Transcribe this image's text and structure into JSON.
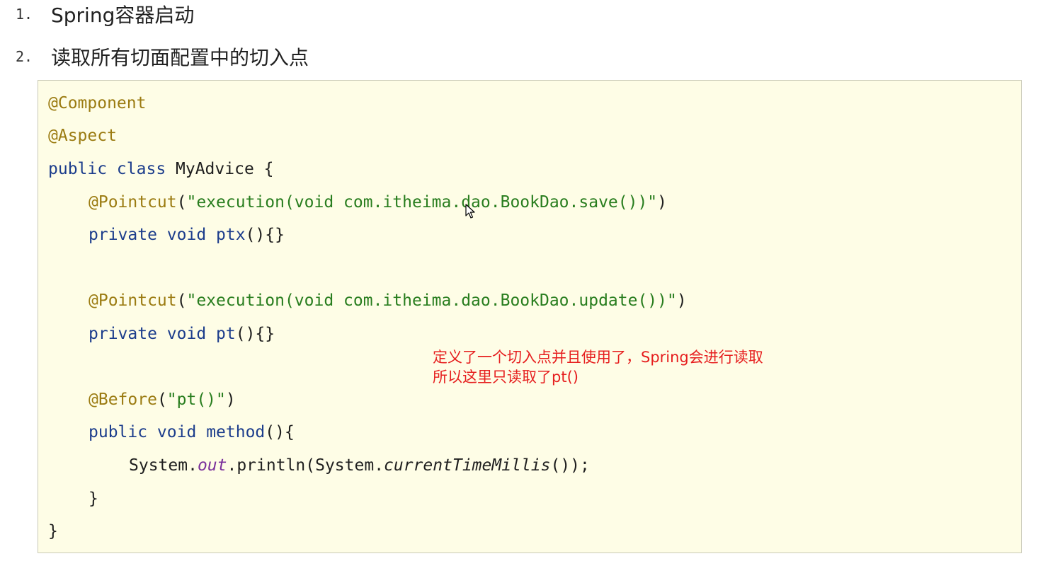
{
  "list": [
    {
      "number": "1.",
      "text": "Spring容器启动"
    },
    {
      "number": "2.",
      "text": "读取所有切面配置中的切入点"
    }
  ],
  "code": {
    "l1_ann": "@Component",
    "l2_ann": "@Aspect",
    "l3_kw": "public class",
    "l3_rest": " MyAdvice {",
    "l4_ann": "@Pointcut",
    "l4_str": "\"execution(void com.itheima.dao.BookDao.save())\"",
    "l5_kw": "private void",
    "l5_fn": "ptx",
    "l5_rest": "(){}",
    "l7_ann": "@Pointcut",
    "l7_str": "\"execution(void com.itheima.dao.BookDao.update())\"",
    "l8_kw": "private void",
    "l8_fn": "pt",
    "l8_rest": "(){}",
    "l10_ann": "@Before",
    "l10_str": "\"pt()\"",
    "l11_kw": "public void",
    "l11_fn": "method",
    "l11_rest": "(){",
    "l12_a": "System.",
    "l12_field": "out",
    "l12_b": ".println(System.",
    "l12_it": "currentTimeMillis",
    "l12_c": "());",
    "l13": "}",
    "l14": "}"
  },
  "annotation_note": {
    "line1": "定义了一个切入点并且使用了，Spring会进行读取",
    "line2": "所以这里只读取了pt()"
  }
}
